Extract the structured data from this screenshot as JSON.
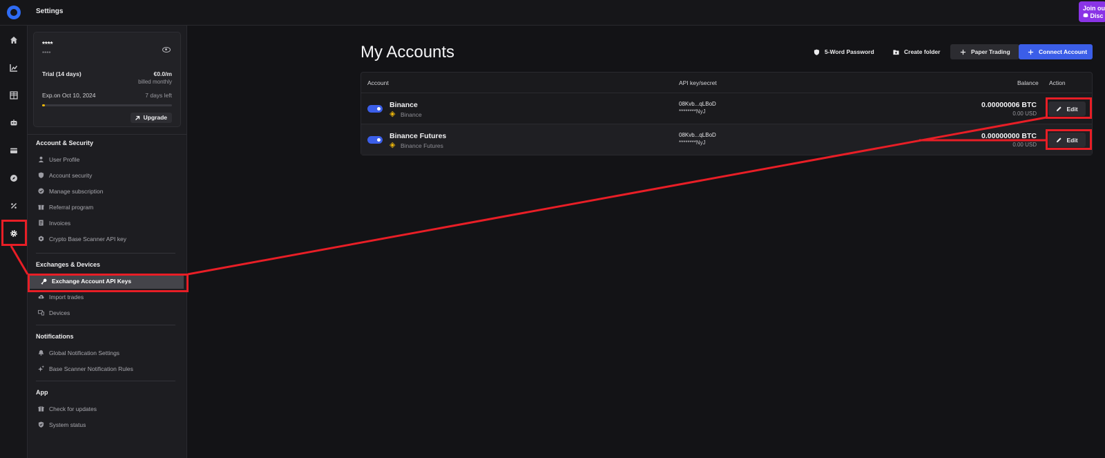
{
  "topbar": {
    "title": "Settings",
    "discord_line1": "Join our",
    "discord_line2": "Disc"
  },
  "rail": {
    "icons": [
      "home-icon",
      "chart-icon",
      "grid-icon",
      "bot-icon",
      "wallet-icon",
      "compass-icon",
      "percent-icon",
      "gear-icon"
    ]
  },
  "subscription": {
    "name": "****",
    "email": "****",
    "plan": "Trial (14 days)",
    "price": "€0.0/m",
    "billing": "billed monthly",
    "expiry": "Exp.on Oct 10, 2024",
    "days_left": "7 days left",
    "progress": 0.02,
    "progress_color": "#f0b90b",
    "upgrade_label": "Upgrade"
  },
  "sections": {
    "account": {
      "title": "Account & Security",
      "items": [
        "User Profile",
        "Account security",
        "Manage subscription",
        "Referral program",
        "Invoices",
        "Crypto Base Scanner API key"
      ]
    },
    "exchanges": {
      "title": "Exchanges & Devices",
      "items": [
        "Exchange Account API Keys",
        "Import trades",
        "Devices"
      ]
    },
    "notifications": {
      "title": "Notifications",
      "items": [
        "Global Notification Settings",
        "Base Scanner Notification Rules"
      ]
    },
    "app": {
      "title": "App",
      "items": [
        "Check for updates",
        "System status"
      ]
    }
  },
  "main": {
    "title": "My Accounts",
    "toolbar": {
      "password": "5-Word Password",
      "folder": "Create folder",
      "paper": "Paper Trading",
      "connect": "Connect Account"
    },
    "columns": {
      "account": "Account",
      "api": "API key/secret",
      "balance": "Balance",
      "action": "Action"
    },
    "rows": [
      {
        "name": "Binance",
        "exchange": "Binance",
        "api_key": "08Kvb...qLBoD",
        "api_secret": "********NyJ",
        "balance": "0.00000006 BTC",
        "balance_usd": "0.00 USD",
        "enabled": true,
        "edit": "Edit"
      },
      {
        "name": "Binance Futures",
        "exchange": "Binance Futures",
        "api_key": "08Kvb...qLBoD",
        "api_secret": "********NyJ",
        "balance": "0.00000000 BTC",
        "balance_usd": "0.00 USD",
        "enabled": true,
        "edit": "Edit"
      }
    ]
  },
  "colors": {
    "accent": "#3b5ee8",
    "highlight": "#e81e26",
    "binance": "#f0b90b"
  }
}
